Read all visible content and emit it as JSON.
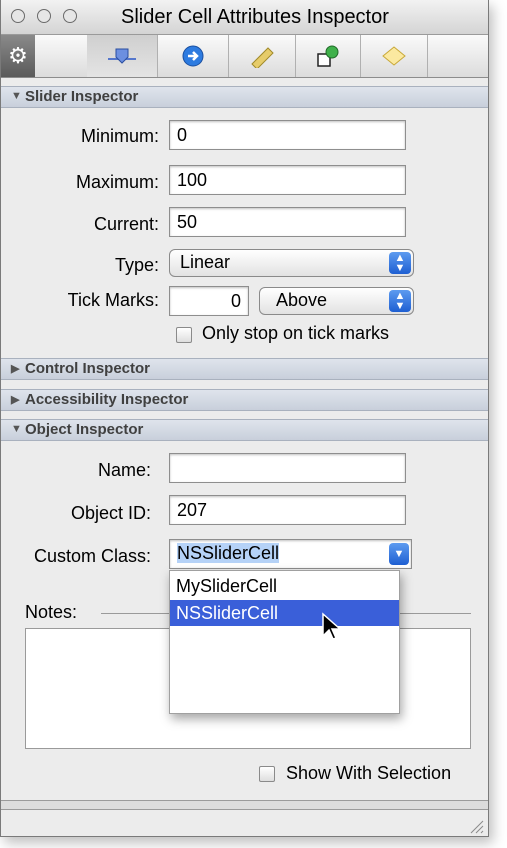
{
  "window": {
    "title": "Slider Cell Attributes Inspector"
  },
  "toolbar": {
    "tabs": [
      {
        "name": "attributes-tab",
        "icon": "slider-icon",
        "selected": true
      },
      {
        "name": "connections-tab",
        "icon": "arrow-circle-icon",
        "selected": false
      },
      {
        "name": "size-tab",
        "icon": "ruler-icon",
        "selected": false
      },
      {
        "name": "bindings-tab",
        "icon": "shapes-icon",
        "selected": false
      },
      {
        "name": "effects-tab",
        "icon": "diamond-icon",
        "selected": false
      }
    ]
  },
  "slider": {
    "header": "Slider Inspector",
    "minimum_label": "Minimum:",
    "minimum": "0",
    "maximum_label": "Maximum:",
    "maximum": "100",
    "current_label": "Current:",
    "current": "50",
    "type_label": "Type:",
    "type": "Linear",
    "tick_label": "Tick Marks:",
    "ticks": "0",
    "tick_position": "Above",
    "stop_label": "Only stop on tick marks"
  },
  "control": {
    "header": "Control Inspector"
  },
  "accessibility": {
    "header": "Accessibility Inspector"
  },
  "object": {
    "header": "Object Inspector",
    "name_label": "Name:",
    "name": "",
    "id_label": "Object ID:",
    "id": "207",
    "class_label": "Custom Class:",
    "class": "NSSliderCell",
    "class_options": [
      "MySliderCell",
      "NSSliderCell"
    ],
    "notes_label": "Notes:",
    "show_label": "Show With Selection"
  },
  "colors": {
    "highlight": "#3a5fd9",
    "header_bg": "#d4dae4"
  }
}
